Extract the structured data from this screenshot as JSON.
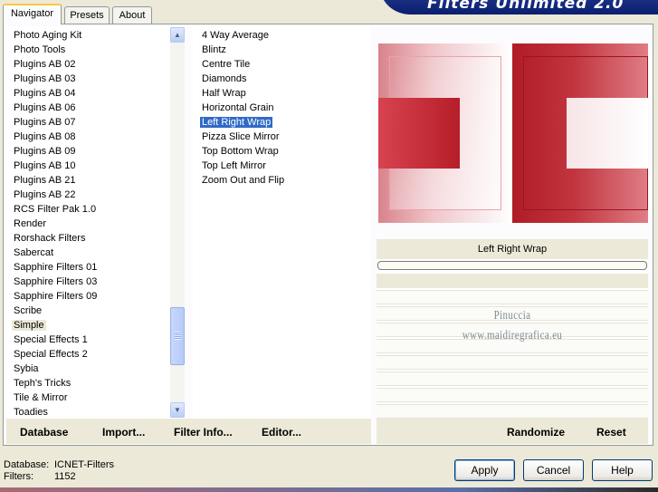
{
  "tabs": [
    {
      "label": "Navigator",
      "active": true
    },
    {
      "label": "Presets",
      "active": false
    },
    {
      "label": "About",
      "active": false
    }
  ],
  "banner": {
    "title": "Filters Unlimited 2.0"
  },
  "categories": {
    "items": [
      "Photo Aging Kit",
      "Photo Tools",
      "Plugins AB 02",
      "Plugins AB 03",
      "Plugins AB 04",
      "Plugins AB 06",
      "Plugins AB 07",
      "Plugins AB 08",
      "Plugins AB 09",
      "Plugins AB 10",
      "Plugins AB 21",
      "Plugins AB 22",
      "RCS Filter Pak 1.0",
      "Render",
      "Rorshack Filters",
      "Sabercat",
      "Sapphire Filters 01",
      "Sapphire Filters 03",
      "Sapphire Filters 09",
      "Scribe",
      "Simple",
      "Special Effects 1",
      "Special Effects 2",
      "Sybia",
      "Teph's Tricks",
      "Tile & Mirror",
      "Toadies"
    ],
    "selected": "Simple"
  },
  "filters": {
    "items": [
      "4 Way Average",
      "Blintz",
      "Centre Tile",
      "Diamonds",
      "Half Wrap",
      "Horizontal Grain",
      "Left Right Wrap",
      "Pizza Slice Mirror",
      "Top Bottom Wrap",
      "Top Left Mirror",
      "Zoom Out and Flip"
    ],
    "selected": "Left Right Wrap"
  },
  "preview": {
    "filter_name": "Left Right Wrap",
    "colors": {
      "dark_red": "#b61e29",
      "light_pink": "#efc5c9"
    }
  },
  "watermark": {
    "line1": "Pinuccia",
    "line2": "www.maidiregrafica.eu"
  },
  "left_links": {
    "database": "Database",
    "import": "Import...",
    "filter_info": "Filter Info...",
    "editor": "Editor..."
  },
  "right_links": {
    "randomize": "Randomize",
    "reset": "Reset"
  },
  "status": {
    "database_label": "Database:",
    "database_value": "ICNET-Filters",
    "filters_label": "Filters:",
    "filters_value": "1152"
  },
  "buttons": {
    "apply": "Apply",
    "cancel": "Cancel",
    "help": "Help"
  },
  "icons": {
    "scroll_up": "chevron-up-icon",
    "scroll_down": "chevron-down-icon"
  }
}
